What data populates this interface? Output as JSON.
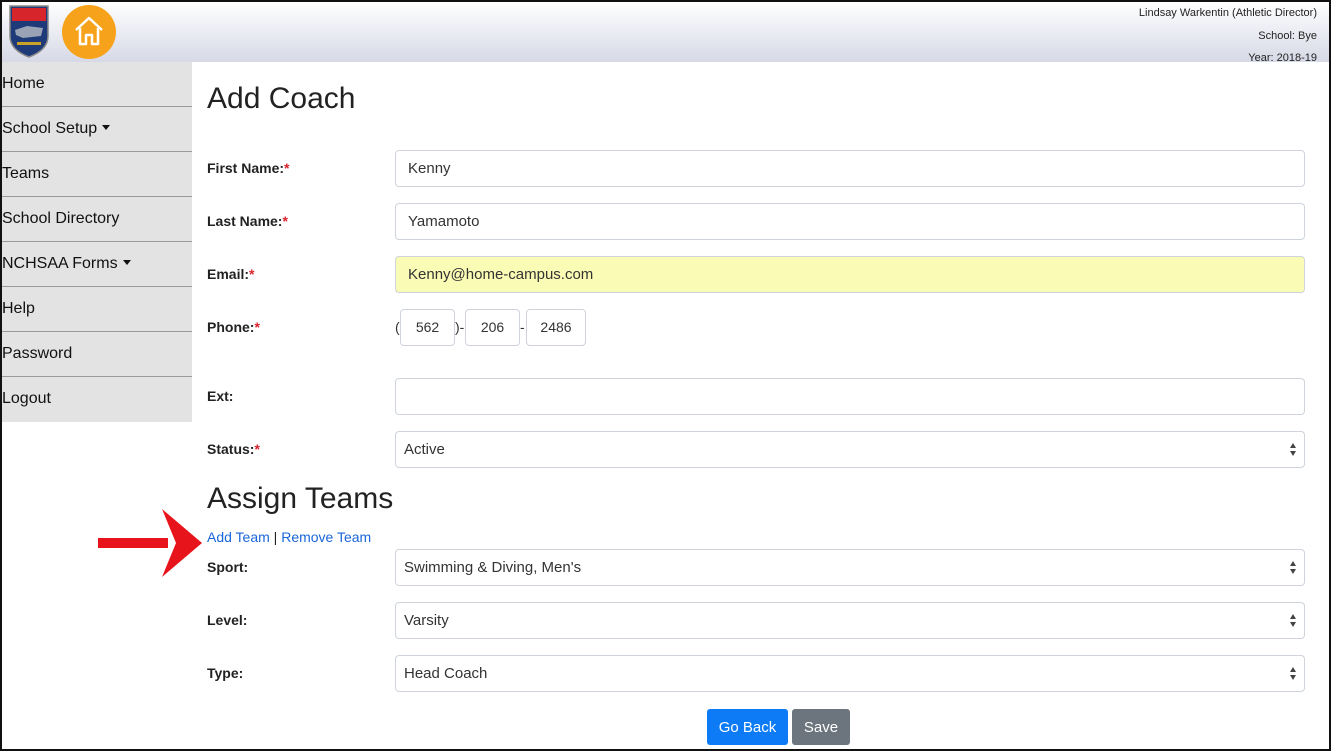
{
  "header": {
    "logo_text": "NCHSAA",
    "user_name": "Lindsay Warkentin (Athletic Director)",
    "school": "School: Bye",
    "year": "Year: 2018-19",
    "brand_orange": "#f7a21b"
  },
  "sidebar": {
    "items": [
      {
        "label": "Home",
        "has_dropdown": false
      },
      {
        "label": "School Setup",
        "has_dropdown": true
      },
      {
        "label": "Teams",
        "has_dropdown": false
      },
      {
        "label": "School Directory",
        "has_dropdown": false
      },
      {
        "label": "NCHSAA Forms",
        "has_dropdown": true
      },
      {
        "label": "Help",
        "has_dropdown": false
      },
      {
        "label": "Password",
        "has_dropdown": false
      },
      {
        "label": "Logout",
        "has_dropdown": false
      }
    ]
  },
  "form": {
    "title": "Add Coach",
    "required_marker": "*",
    "first_name": {
      "label": "First Name:",
      "value": "Kenny"
    },
    "last_name": {
      "label": "Last Name:",
      "value": "Yamamoto"
    },
    "email": {
      "label": "Email:",
      "value": "Kenny@home-campus.com"
    },
    "phone": {
      "label": "Phone:",
      "open_paren": "(",
      "close_paren": ")-",
      "dash": "-",
      "area_code": "562",
      "prefix": "206",
      "line": "2486"
    },
    "ext": {
      "label": "Ext:",
      "value": ""
    },
    "status": {
      "label": "Status:",
      "value": "Active"
    }
  },
  "assign": {
    "title": "Assign Teams",
    "add_team": "Add Team",
    "separator": "|",
    "remove_team": "Remove Team",
    "sport": {
      "label": "Sport:",
      "value": "Swimming & Diving, Men's"
    },
    "level": {
      "label": "Level:",
      "value": "Varsity"
    },
    "type": {
      "label": "Type:",
      "value": "Head Coach"
    }
  },
  "buttons": {
    "go_back": "Go Back",
    "save": "Save"
  },
  "colors": {
    "primary": "#0d7bf5",
    "secondary": "#6c757d",
    "required": "#d9232e",
    "link": "#1a66d9",
    "annotation_arrow": "#e8141b",
    "autofill": "#fafcb5"
  }
}
